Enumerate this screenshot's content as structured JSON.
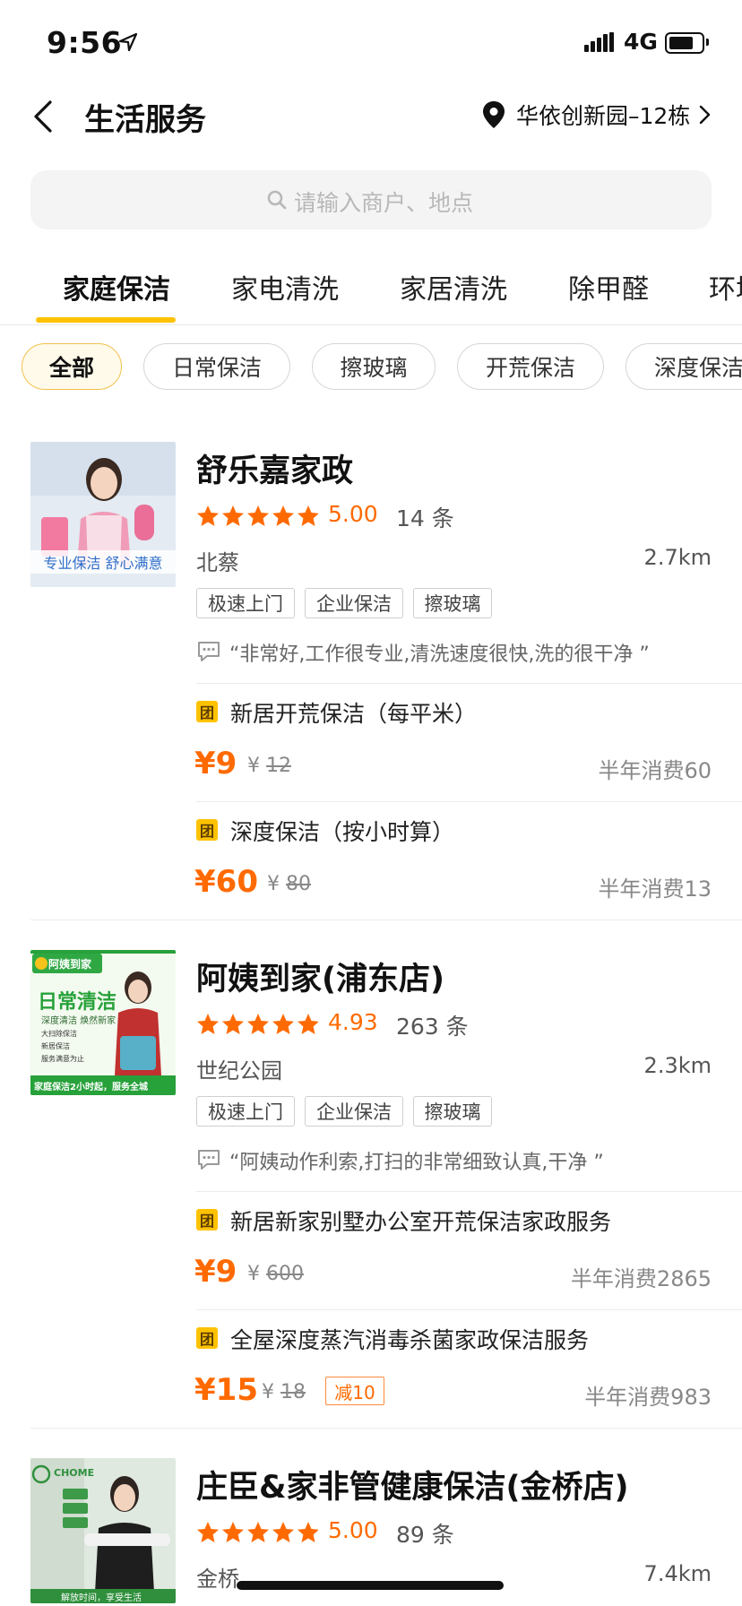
{
  "status_bar": {
    "time": "9:56",
    "network": "4G"
  },
  "header": {
    "title": "生活服务",
    "location": "华依创新园–12栋"
  },
  "search": {
    "placeholder": "请输入商户、地点"
  },
  "tabs": [
    "家庭保洁",
    "家电清洗",
    "家居清洗",
    "除甲醛",
    "环境"
  ],
  "chips": [
    "全部",
    "日常保洁",
    "擦玻璃",
    "开荒保洁",
    "深度保洁"
  ],
  "colors": {
    "accent": "#ffc200",
    "price": "#ff6a00"
  },
  "shops": [
    {
      "name": "舒乐嘉家政",
      "rating": "5.00",
      "reviews": "14 条",
      "area": "北蔡",
      "distance": "2.7km",
      "tags": [
        "极速上门",
        "企业保洁",
        "擦玻璃"
      ],
      "quote": "“非常好,工作很专业,清洗速度很快,洗的很干净 ”",
      "thumb_caption": "专业保洁 舒心满意",
      "deals": [
        {
          "badge": "团",
          "title": "新居开荒保洁（每平米）",
          "price": "¥9",
          "orig_symbol": "¥",
          "orig": "12",
          "sales": "半年消费60"
        },
        {
          "badge": "团",
          "title": "深度保洁（按小时算）",
          "price": "¥60",
          "orig_symbol": "¥",
          "orig": "80",
          "sales": "半年消费13"
        }
      ]
    },
    {
      "name": "阿姨到家(浦东店)",
      "rating": "4.93",
      "reviews": "263 条",
      "area": "世纪公园",
      "distance": "2.3km",
      "tags": [
        "极速上门",
        "企业保洁",
        "擦玻璃"
      ],
      "quote": "“阿姨动作利索,打扫的非常细致认真,干净 ”",
      "thumb_brand": "阿姨到家",
      "thumb_headline": "日常清洁",
      "thumb_sub": "深度清洁 焕然新家",
      "thumb_items": [
        "大扫除保洁",
        "新居保洁",
        "服务满意为止"
      ],
      "thumb_footer": "家庭保洁2小时起，服务全城",
      "deals": [
        {
          "badge": "团",
          "title": "新居新家别墅办公室开荒保洁家政服务",
          "price": "¥9",
          "orig_symbol": "¥",
          "orig": "600",
          "sales": "半年消费2865"
        },
        {
          "badge": "团",
          "title": "全屋深度蒸汽消毒杀菌家政保洁服务",
          "price": "¥15",
          "orig_symbol": "¥",
          "orig": "18",
          "promo": "减10",
          "sales": "半年消费983"
        }
      ]
    },
    {
      "name": "庄臣&家非管健康保洁(金桥店)",
      "rating": "5.00",
      "reviews": "89 条",
      "area": "金桥",
      "distance": "7.4km",
      "thumb_brand": "CHOME",
      "thumb_footer": "解放时间，享受生活"
    }
  ]
}
